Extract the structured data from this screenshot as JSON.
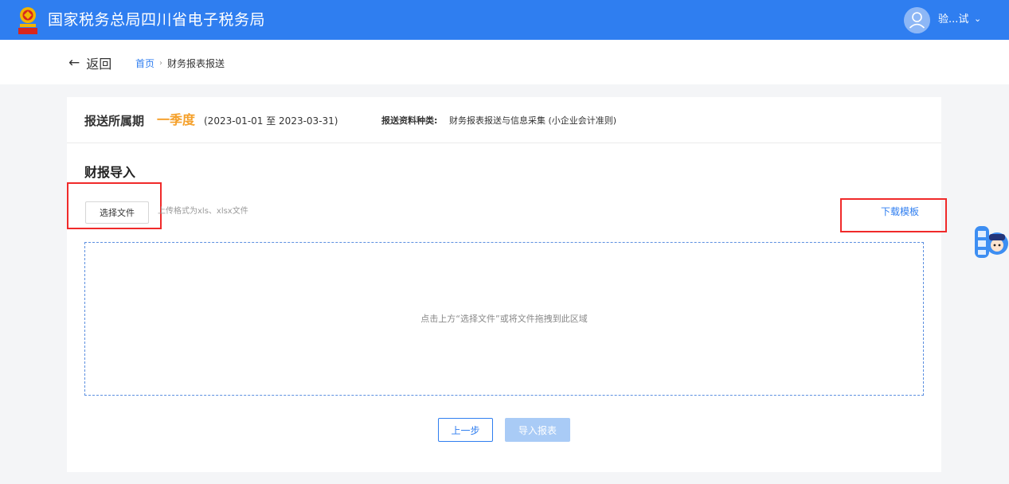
{
  "header": {
    "title": "国家税务总局四川省电子税务局",
    "username": "验...试",
    "caret": "⌄",
    "colors": {
      "bar": "#2f7ef0",
      "accent": "#2f7ef0",
      "period": "#f5a02a",
      "highlight": "#f02a2a"
    }
  },
  "nav": {
    "back_arrow": "←",
    "back_label": "返回",
    "breadcrumb": {
      "home": "首页",
      "separator": "›",
      "current": "财务报表报送"
    }
  },
  "period": {
    "label": "报送所属期",
    "value": "一季度",
    "range": "(2023-01-01 至 2023-03-31)",
    "type_label": "报送资料种类:",
    "type_value": "财务报表报送与信息采集 (小企业会计准则)"
  },
  "import": {
    "title": "财报导入",
    "choose_file": "选择文件",
    "hint": "上传格式为xls、xlsx文件",
    "download_template": "下载模板",
    "dropzone_text": "点击上方“选择文件”或将文件拖拽到此区域"
  },
  "actions": {
    "prev": "上一步",
    "import": "导入报表"
  },
  "icons": {
    "emblem": "tax-emblem-icon",
    "avatar": "user-avatar-icon",
    "assistant": "tax-assistant-icon"
  }
}
